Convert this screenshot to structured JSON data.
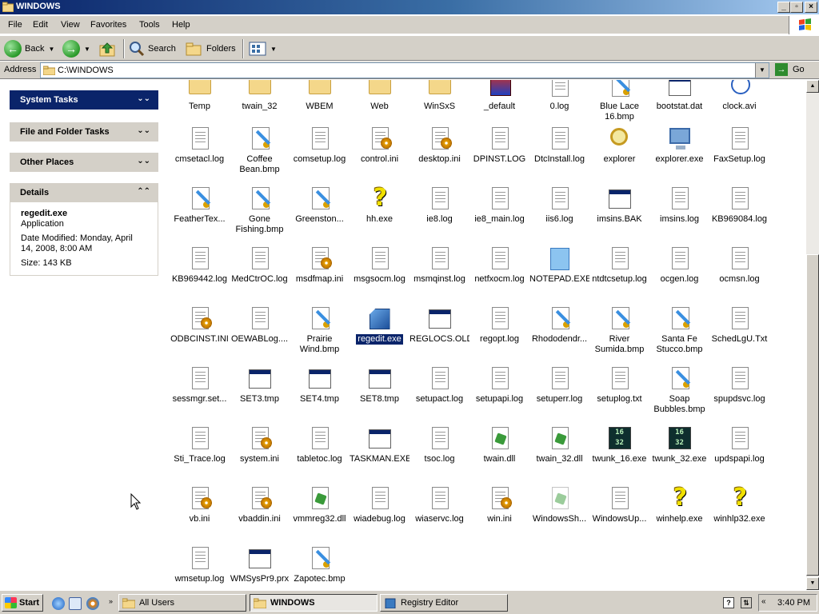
{
  "window": {
    "title": "WINDOWS"
  },
  "menu": [
    "File",
    "Edit",
    "View",
    "Favorites",
    "Tools",
    "Help"
  ],
  "toolbar": {
    "back": "Back",
    "search": "Search",
    "folders": "Folders"
  },
  "address": {
    "label": "Address",
    "value": "C:\\WINDOWS",
    "go": "Go"
  },
  "sidebar": {
    "system_tasks": "System Tasks",
    "file_folder_tasks": "File and Folder Tasks",
    "other_places": "Other Places",
    "details": {
      "title": "Details",
      "name": "regedit.exe",
      "type": "Application",
      "modified": "Date Modified: Monday, April 14, 2008, 8:00 AM",
      "size": "Size: 143 KB"
    }
  },
  "files": [
    {
      "label": "Temp",
      "icon": "folder"
    },
    {
      "label": "twain_32",
      "icon": "folder"
    },
    {
      "label": "WBEM",
      "icon": "folder"
    },
    {
      "label": "Web",
      "icon": "folder"
    },
    {
      "label": "WinSxS",
      "icon": "folder"
    },
    {
      "label": "_default",
      "icon": "default"
    },
    {
      "label": "0.log",
      "icon": "doc"
    },
    {
      "label": "Blue Lace\n16.bmp",
      "icon": "brush"
    },
    {
      "label": "bootstat.dat",
      "icon": "app"
    },
    {
      "label": "clock.avi",
      "icon": "avi"
    },
    {
      "label": "cmsetacl.log",
      "icon": "doc"
    },
    {
      "label": "Coffee\nBean.bmp",
      "icon": "brush"
    },
    {
      "label": "comsetup.log",
      "icon": "doc"
    },
    {
      "label": "control.ini",
      "icon": "gear"
    },
    {
      "label": "desktop.ini",
      "icon": "gear"
    },
    {
      "label": "DPINST.LOG",
      "icon": "doc"
    },
    {
      "label": "DtcInstall.log",
      "icon": "doc"
    },
    {
      "label": "explorer",
      "icon": "mag"
    },
    {
      "label": "explorer.exe",
      "icon": "pc"
    },
    {
      "label": "FaxSetup.log",
      "icon": "doc"
    },
    {
      "label": "FeatherTex...",
      "icon": "brush"
    },
    {
      "label": "Gone\nFishing.bmp",
      "icon": "brush"
    },
    {
      "label": "Greenston...",
      "icon": "brush"
    },
    {
      "label": "hh.exe",
      "icon": "q"
    },
    {
      "label": "ie8.log",
      "icon": "doc"
    },
    {
      "label": "ie8_main.log",
      "icon": "doc"
    },
    {
      "label": "iis6.log",
      "icon": "doc"
    },
    {
      "label": "imsins.BAK",
      "icon": "app"
    },
    {
      "label": "imsins.log",
      "icon": "doc"
    },
    {
      "label": "KB969084.log",
      "icon": "doc"
    },
    {
      "label": "KB969442.log",
      "icon": "doc"
    },
    {
      "label": "MedCtrOC.log",
      "icon": "doc"
    },
    {
      "label": "msdfmap.ini",
      "icon": "gear"
    },
    {
      "label": "msgsocm.log",
      "icon": "doc"
    },
    {
      "label": "msmqinst.log",
      "icon": "doc"
    },
    {
      "label": "netfxocm.log",
      "icon": "doc"
    },
    {
      "label": "NOTEPAD.EXE",
      "icon": "ok"
    },
    {
      "label": "ntdtcsetup.log",
      "icon": "doc"
    },
    {
      "label": "ocgen.log",
      "icon": "doc"
    },
    {
      "label": "ocmsn.log",
      "icon": "doc"
    },
    {
      "label": "ODBCINST.INI",
      "icon": "gear"
    },
    {
      "label": "OEWABLog....",
      "icon": "doc"
    },
    {
      "label": "Prairie\nWind.bmp",
      "icon": "brush"
    },
    {
      "label": "regedit.exe",
      "icon": "reg",
      "selected": true
    },
    {
      "label": "REGLOCS.OLD",
      "icon": "app"
    },
    {
      "label": "regopt.log",
      "icon": "doc"
    },
    {
      "label": "Rhododendr...",
      "icon": "brush"
    },
    {
      "label": "River\nSumida.bmp",
      "icon": "brush"
    },
    {
      "label": "Santa Fe\nStucco.bmp",
      "icon": "brush"
    },
    {
      "label": "SchedLgU.Txt",
      "icon": "doc"
    },
    {
      "label": "sessmgr.set...",
      "icon": "doc"
    },
    {
      "label": "SET3.tmp",
      "icon": "app"
    },
    {
      "label": "SET4.tmp",
      "icon": "app"
    },
    {
      "label": "SET8.tmp",
      "icon": "app"
    },
    {
      "label": "setupact.log",
      "icon": "doc"
    },
    {
      "label": "setupapi.log",
      "icon": "doc"
    },
    {
      "label": "setuperr.log",
      "icon": "doc"
    },
    {
      "label": "setuplog.txt",
      "icon": "doc"
    },
    {
      "label": "Soap\nBubbles.bmp",
      "icon": "brush"
    },
    {
      "label": "spupdsvc.log",
      "icon": "doc"
    },
    {
      "label": "Sti_Trace.log",
      "icon": "doc"
    },
    {
      "label": "system.ini",
      "icon": "gear"
    },
    {
      "label": "tabletoc.log",
      "icon": "doc"
    },
    {
      "label": "TASKMAN.EXE",
      "icon": "app"
    },
    {
      "label": "tsoc.log",
      "icon": "doc"
    },
    {
      "label": "twain.dll",
      "icon": "dll"
    },
    {
      "label": "twain_32.dll",
      "icon": "dll"
    },
    {
      "label": "twunk_16.exe",
      "icon": "n16"
    },
    {
      "label": "twunk_32.exe",
      "icon": "n32"
    },
    {
      "label": "updspapi.log",
      "icon": "doc"
    },
    {
      "label": "vb.ini",
      "icon": "gear"
    },
    {
      "label": "vbaddin.ini",
      "icon": "gear"
    },
    {
      "label": "vmmreg32.dll",
      "icon": "dll"
    },
    {
      "label": "wiadebug.log",
      "icon": "doc"
    },
    {
      "label": "wiaservc.log",
      "icon": "doc"
    },
    {
      "label": "win.ini",
      "icon": "gear"
    },
    {
      "label": "WindowsSh...",
      "icon": "dllfaint"
    },
    {
      "label": "WindowsUp...",
      "icon": "doc"
    },
    {
      "label": "winhelp.exe",
      "icon": "q"
    },
    {
      "label": "winhlp32.exe",
      "icon": "q"
    },
    {
      "label": "wmsetup.log",
      "icon": "doc"
    },
    {
      "label": "WMSysPr9.prx",
      "icon": "app"
    },
    {
      "label": "Zapotec.bmp",
      "icon": "brush"
    }
  ],
  "taskbar": {
    "start": "Start",
    "buttons": [
      {
        "label": "All Users"
      },
      {
        "label": "WINDOWS",
        "active": true
      },
      {
        "label": "Registry Editor"
      }
    ],
    "clock": "3:40 PM"
  }
}
